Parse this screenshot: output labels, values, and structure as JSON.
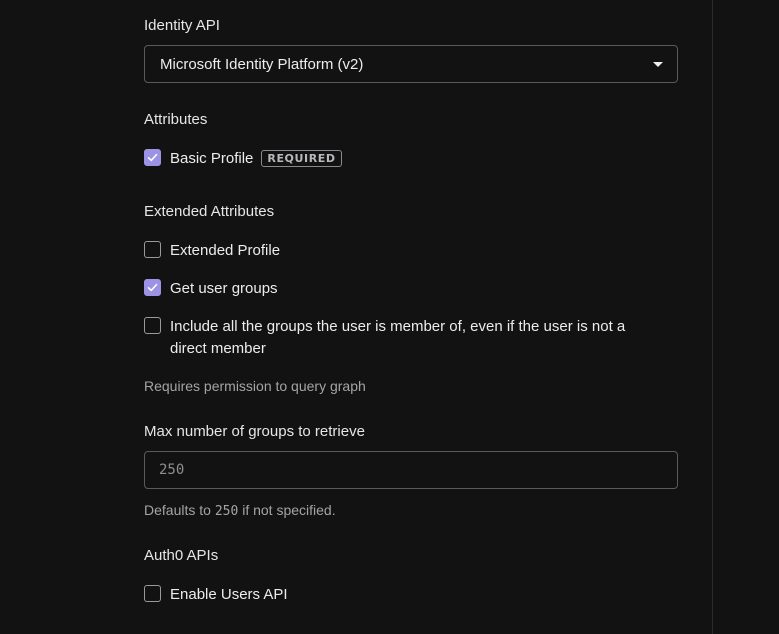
{
  "identity_api": {
    "label": "Identity API",
    "selected": "Microsoft Identity Platform (v2)"
  },
  "attributes": {
    "heading": "Attributes",
    "basic_profile": {
      "label": "Basic Profile",
      "badge": "REQUIRED",
      "checked": true
    }
  },
  "extended_attributes": {
    "heading": "Extended Attributes",
    "extended_profile": {
      "label": "Extended Profile",
      "checked": false
    },
    "get_user_groups": {
      "label": "Get user groups",
      "checked": true
    },
    "include_all_groups": {
      "label_line1": "Include all the groups the user is member of, even if the user is not a",
      "label_line2": "direct member",
      "checked": false
    },
    "helper": "Requires permission to query graph"
  },
  "max_groups": {
    "label": "Max number of groups to retrieve",
    "placeholder": "250",
    "helper_prefix": "Defaults to ",
    "helper_code": "250",
    "helper_suffix": " if not specified."
  },
  "auth0_apis": {
    "heading": "Auth0 APIs",
    "enable_users_api": {
      "label": "Enable Users API",
      "checked": false
    }
  },
  "colors": {
    "background": "#121212",
    "accent_checkbox": "#9c92e6",
    "border": "#5a5a5e"
  }
}
